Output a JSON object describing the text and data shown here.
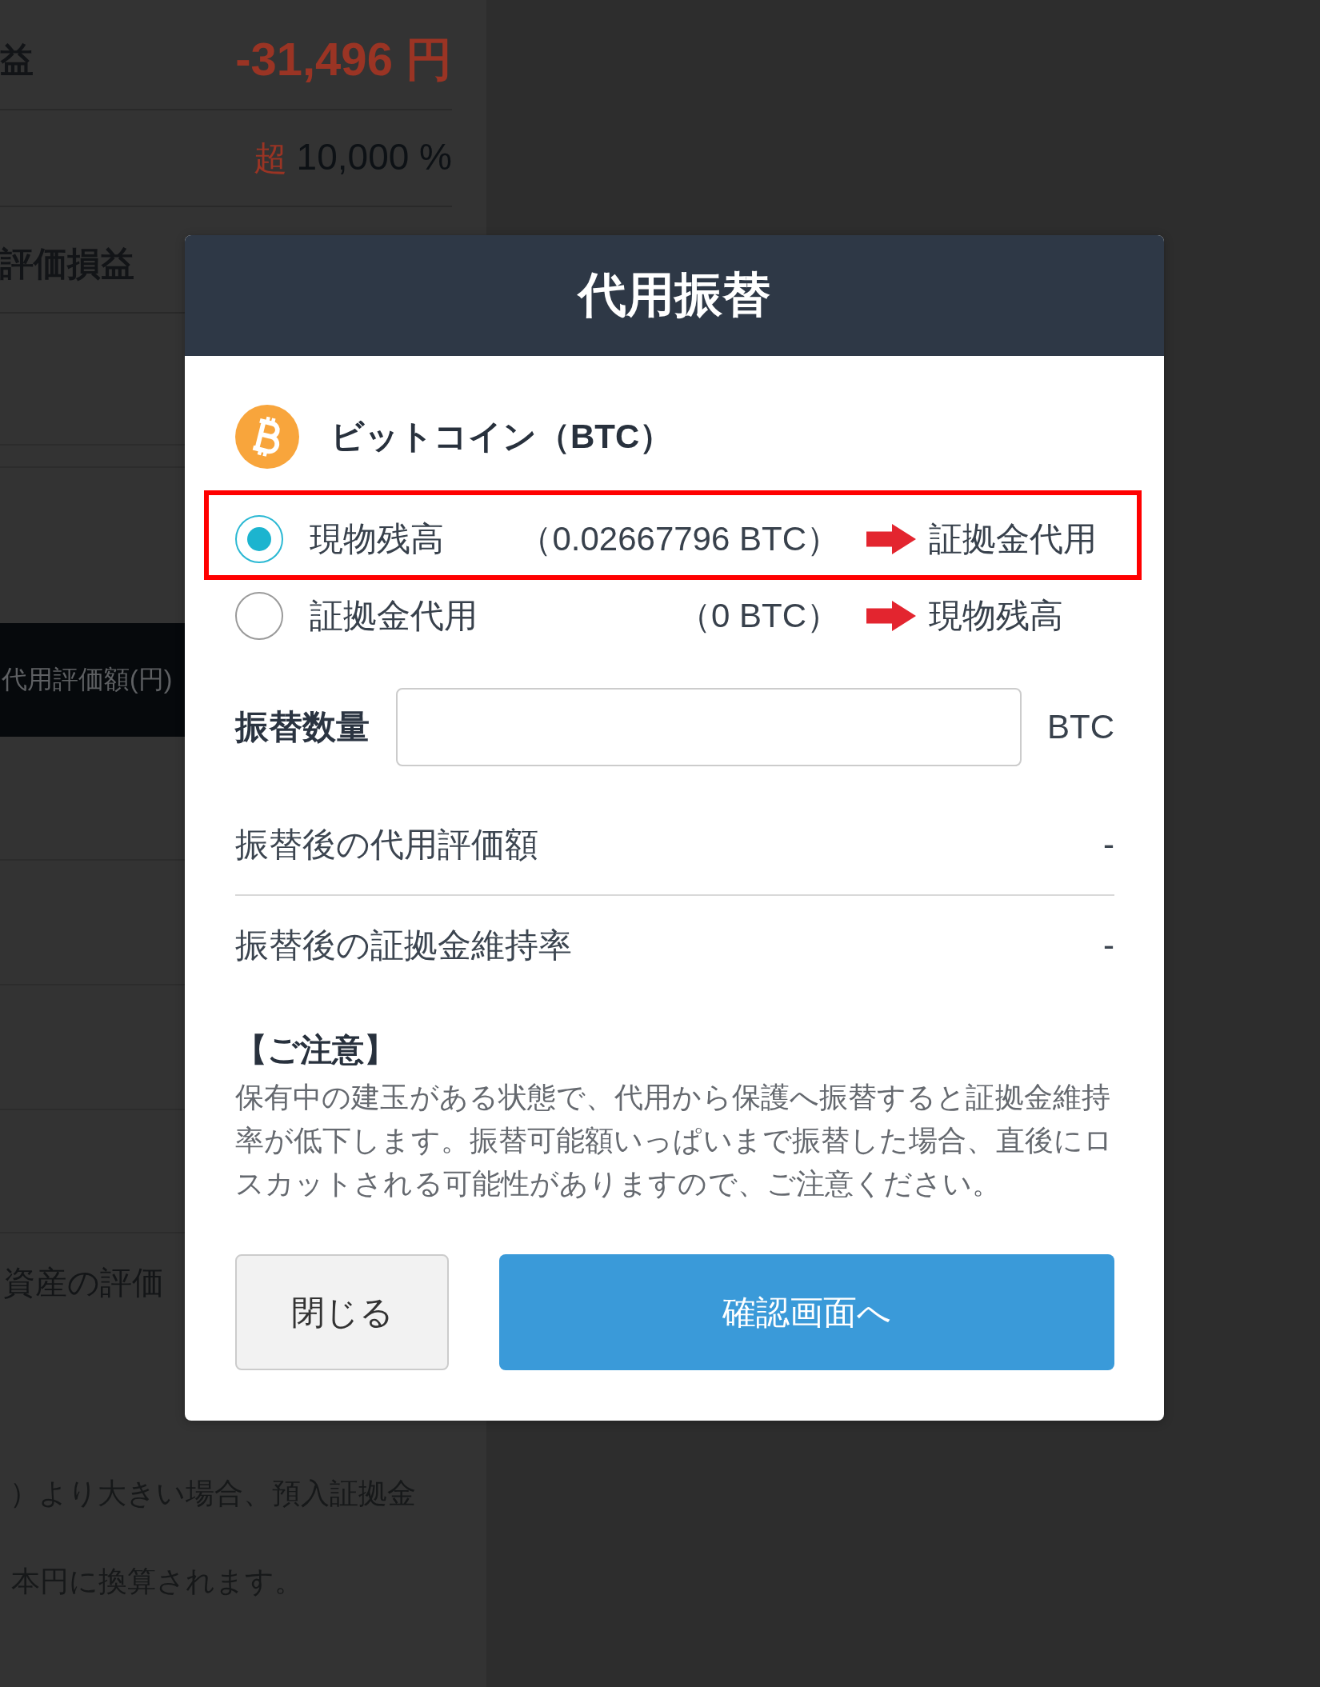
{
  "background": {
    "summary_rows": [
      {
        "kind": "loss",
        "label": "益",
        "value": "-31,496 円"
      },
      {
        "kind": "rate",
        "prefix": "超",
        "value": "10,000 %"
      },
      {
        "kind": "heading",
        "label": "評価損益"
      }
    ],
    "table_header": "代用評価額(円)",
    "row_label": "資産の評価",
    "notes": [
      "）より大きい場合、預入証拠金",
      "本円に換算されます。"
    ]
  },
  "dialog": {
    "title": "代用振替",
    "asset": "ビットコイン（BTC）",
    "options": [
      {
        "label": "現物残高",
        "amount": "（0.02667796 BTC）",
        "target": "証拠金代用",
        "selected": true,
        "highlighted": true
      },
      {
        "label": "証拠金代用",
        "amount": "（0 BTC）",
        "target": "現物残高",
        "selected": false,
        "highlighted": false
      }
    ],
    "quantity": {
      "label": "振替数量",
      "unit": "BTC"
    },
    "results": [
      {
        "label": "振替後の代用評価額",
        "value": "-"
      },
      {
        "label": "振替後の証拠金維持率",
        "value": "-"
      }
    ],
    "notice": {
      "title": "【ご注意】",
      "body": "保有中の建玉がある状態で、代用から保護へ振替すると証拠金維持率が低下します。振替可能額いっぱいまで振替した場合、直後にロスカットされる可能性がありますので、ご注意ください。"
    },
    "buttons": [
      {
        "kind": "secondary",
        "label": "閉じる"
      },
      {
        "kind": "primary",
        "label": "確認画面へ"
      }
    ]
  }
}
